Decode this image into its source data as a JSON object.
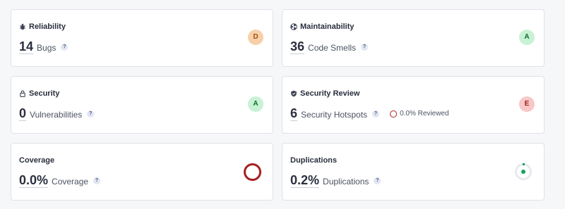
{
  "colors": {
    "grade_d_bg": "#f7d0a9",
    "grade_d_fg": "#a14f14",
    "grade_a_bg": "#c9f2d4",
    "grade_a_fg": "#0f6e35",
    "grade_e_bg": "#f8c7c7",
    "grade_e_fg": "#a11b1b",
    "coverage_ring": "#a81f1f",
    "duplications_dot": "#14a15a"
  },
  "help_glyph": "?",
  "cards": {
    "reliability": {
      "title": "Reliability",
      "icon": "bug-icon",
      "value": "14",
      "label": "Bugs",
      "grade": "D"
    },
    "maintainability": {
      "title": "Maintainability",
      "icon": "radiation-icon",
      "value": "36",
      "label": "Code Smells",
      "grade": "A"
    },
    "security": {
      "title": "Security",
      "icon": "lock-icon",
      "value": "0",
      "label": "Vulnerabilities",
      "grade": "A"
    },
    "security_review": {
      "title": "Security Review",
      "icon": "shield-icon",
      "value": "6",
      "label": "Security Hotspots",
      "reviewed": "0.0% Reviewed",
      "grade": "E"
    },
    "coverage": {
      "title": "Coverage",
      "value": "0.0%",
      "label": "Coverage",
      "percent": 0.0
    },
    "duplications": {
      "title": "Duplications",
      "value": "0.2%",
      "label": "Duplications",
      "percent": 0.2
    }
  }
}
